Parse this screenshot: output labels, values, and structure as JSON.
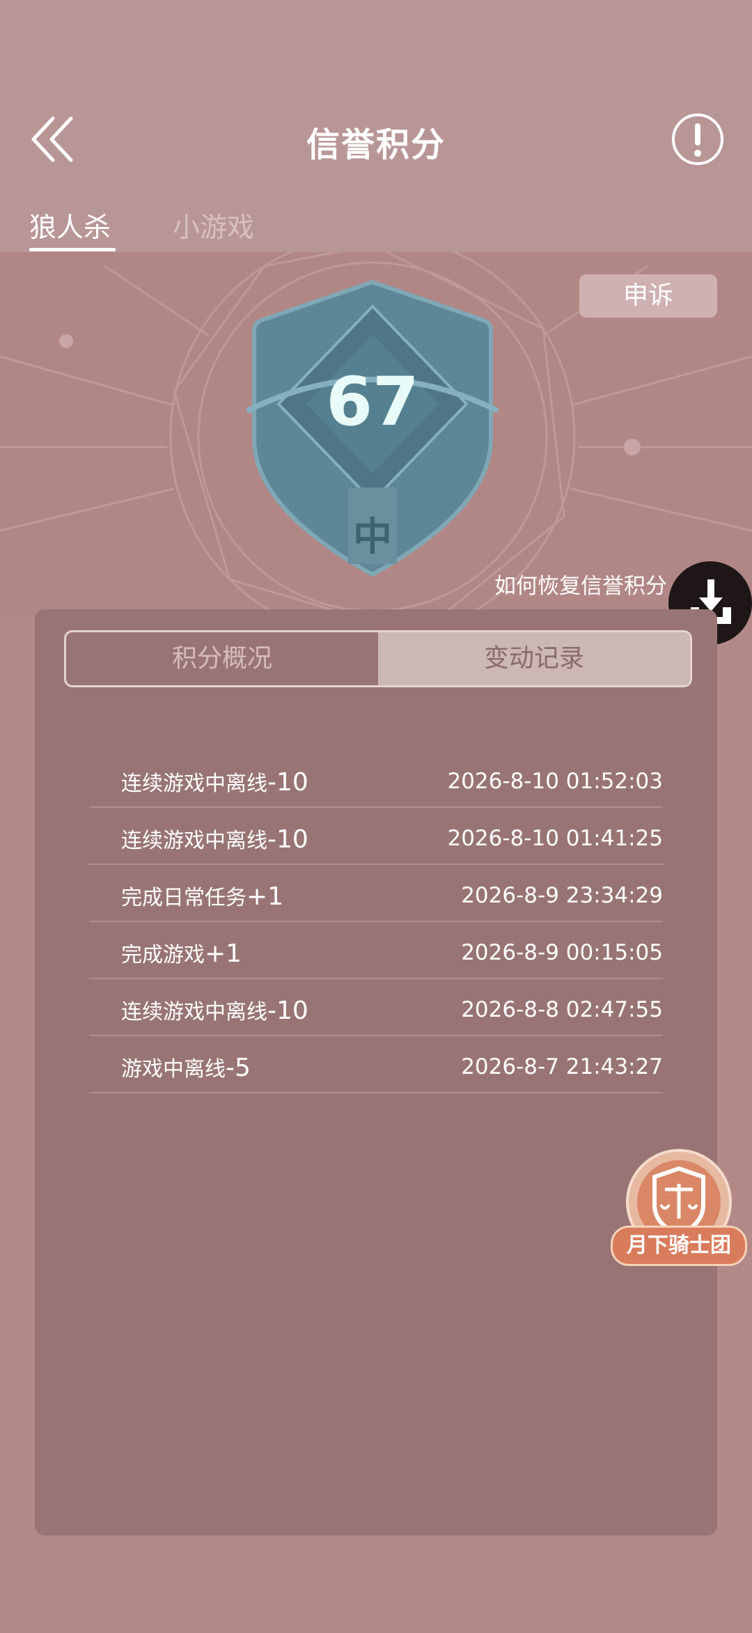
{
  "header": {
    "title": "信誉积分",
    "tabs": [
      {
        "label": "狼人杀",
        "active": true
      },
      {
        "label": "小游戏",
        "active": false
      }
    ]
  },
  "hero": {
    "appeal_label": "申诉",
    "score": "67",
    "level": "中",
    "restore_link": "如何恢复信誉积分"
  },
  "segmented": {
    "left": "积分概况",
    "right": "变动记录",
    "selected": "right"
  },
  "records": [
    {
      "label": "连续游戏中离线",
      "delta": "-10",
      "time": "2026-8-10 01:52:03"
    },
    {
      "label": "连续游戏中离线",
      "delta": "-10",
      "time": "2026-8-10 01:41:25"
    },
    {
      "label": "完成日常任务",
      "delta": "+1",
      "time": "2026-8-9 23:34:29"
    },
    {
      "label": "完成游戏",
      "delta": "+1",
      "time": "2026-8-9 00:15:05"
    },
    {
      "label": "连续游戏中离线",
      "delta": "-10",
      "time": "2026-8-8 02:47:55"
    },
    {
      "label": "游戏中离线",
      "delta": "-5",
      "time": "2026-8-7 21:43:27"
    }
  ],
  "floating": {
    "knight_label": "月下骑士团"
  },
  "colors": {
    "background": "#b38988",
    "panel": "#987574",
    "badge": "#5d8696"
  }
}
